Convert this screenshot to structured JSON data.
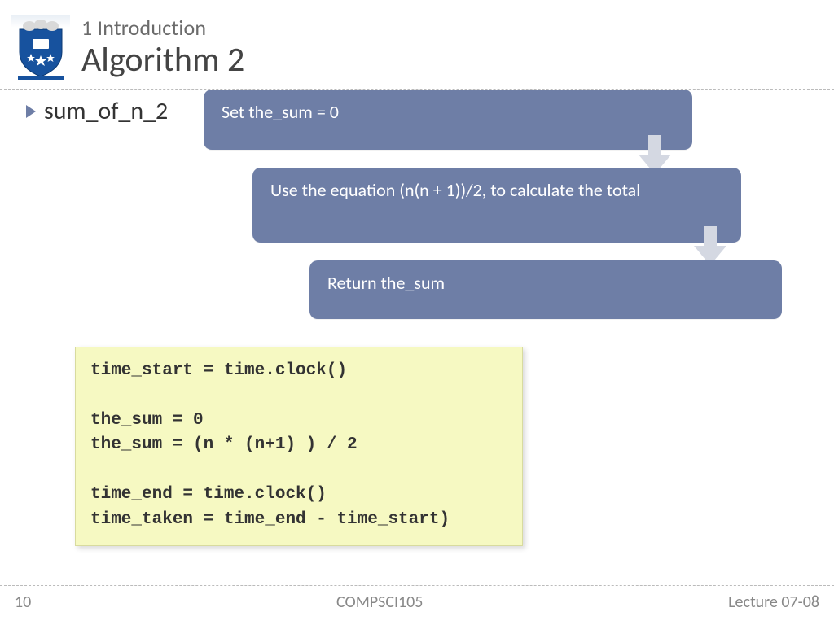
{
  "header": {
    "section_label": "1 Introduction",
    "title": "Algorithm 2"
  },
  "bullet": {
    "label": "sum_of_n_2"
  },
  "steps": {
    "s1": "Set the_sum = 0",
    "s2": "Use the equation (n(n + 1))/2, to calculate the total",
    "s3": "Return the_sum"
  },
  "code": "time_start = time.clock()\n\nthe_sum = 0\nthe_sum = (n * (n+1) ) / 2\n\ntime_end = time.clock()\ntime_taken = time_end - time_start)",
  "footer": {
    "page": "10",
    "course": "COMPSCI105",
    "lecture": "Lecture 07-08"
  },
  "colors": {
    "step_bg": "#6e7ea6",
    "code_bg": "#f6f9c2"
  }
}
